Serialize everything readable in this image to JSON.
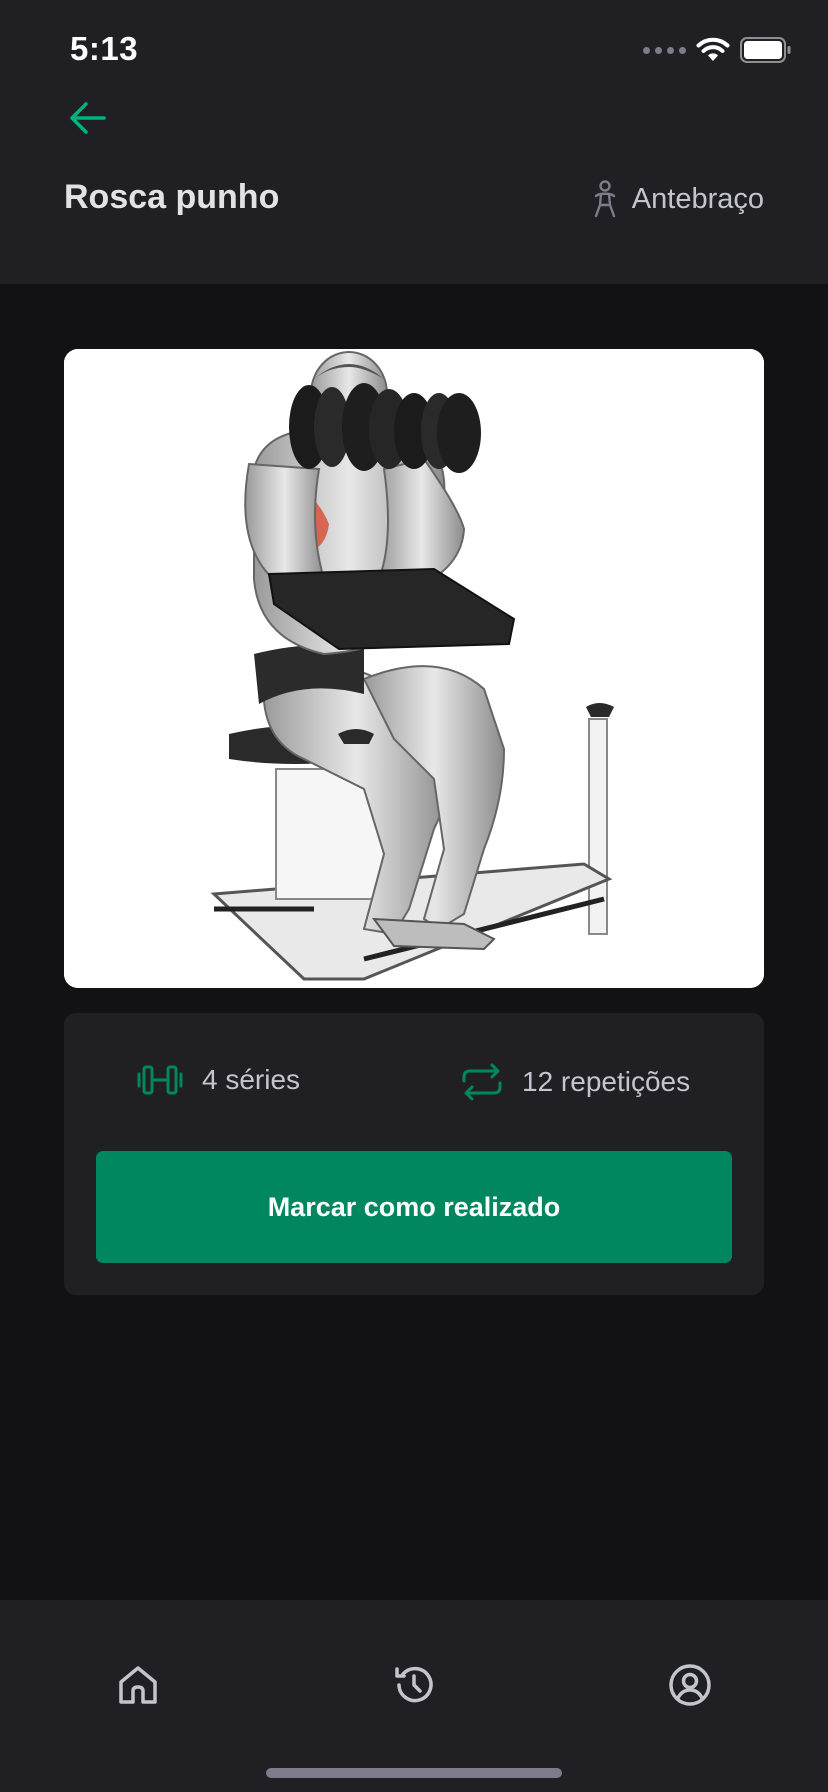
{
  "status_bar": {
    "time": "5:13"
  },
  "header": {
    "title": "Rosca punho",
    "group": "Antebraço"
  },
  "exercise": {
    "series": "4 séries",
    "repetitions": "12 repetições",
    "done_label": "Marcar como realizado"
  },
  "tabbar": {
    "items": [
      {
        "icon": "home-icon"
      },
      {
        "icon": "history-icon"
      },
      {
        "icon": "profile-icon"
      }
    ]
  },
  "colors": {
    "accent": "#00b37e",
    "button": "#00875f",
    "header_bg": "#202024",
    "page_bg": "#121214",
    "card_bg": "#202024",
    "muscle_highlight": "#d9523b"
  }
}
